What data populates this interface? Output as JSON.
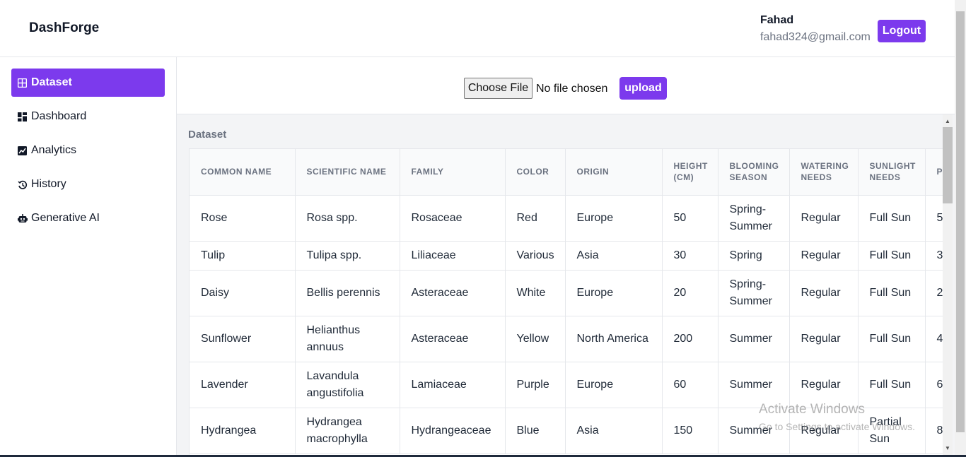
{
  "header": {
    "brand": "DashForge",
    "user_name": "Fahad",
    "user_email": "fahad324@gmail.com",
    "logout_label": "Logout",
    "accent_color": "#7c3aed"
  },
  "sidebar": {
    "items": [
      {
        "label": "Dataset",
        "icon": "grid-icon",
        "active": true
      },
      {
        "label": "Dashboard",
        "icon": "dashboard-icon",
        "active": false
      },
      {
        "label": "Analytics",
        "icon": "chart-icon",
        "active": false
      },
      {
        "label": "History",
        "icon": "history-icon",
        "active": false
      },
      {
        "label": "Generative AI",
        "icon": "robot-icon",
        "active": false
      }
    ]
  },
  "upload": {
    "choose_label": "Choose File",
    "status": "No file chosen",
    "upload_label": "upload"
  },
  "dataset": {
    "title": "Dataset",
    "columns": [
      "COMMON NAME",
      "SCIENTIFIC NAME",
      "FAMILY",
      "COLOR",
      "ORIGIN",
      "HEIGHT (CM)",
      "BLOOMING SEASON",
      "WATERING NEEDS",
      "SUNLIGHT NEEDS",
      "P (S"
    ],
    "rows": [
      [
        "Rose",
        "Rosa spp.",
        "Rosaceae",
        "Red",
        "Europe",
        "50",
        "Spring-Summer",
        "Regular",
        "Full Sun",
        "5"
      ],
      [
        "Tulip",
        "Tulipa spp.",
        "Liliaceae",
        "Various",
        "Asia",
        "30",
        "Spring",
        "Regular",
        "Full Sun",
        "3"
      ],
      [
        "Daisy",
        "Bellis perennis",
        "Asteraceae",
        "White",
        "Europe",
        "20",
        "Spring-Summer",
        "Regular",
        "Full Sun",
        "2"
      ],
      [
        "Sunflower",
        "Helianthus annuus",
        "Asteraceae",
        "Yellow",
        "North America",
        "200",
        "Summer",
        "Regular",
        "Full Sun",
        "4"
      ],
      [
        "Lavender",
        "Lavandula angustifolia",
        "Lamiaceae",
        "Purple",
        "Europe",
        "60",
        "Summer",
        "Regular",
        "Full Sun",
        "6"
      ],
      [
        "Hydrangea",
        "Hydrangea macrophylla",
        "Hydrangeaceae",
        "Blue",
        "Asia",
        "150",
        "Summer",
        "Regular",
        "Partial Sun",
        "8"
      ]
    ]
  },
  "watermark": {
    "title": "Activate Windows",
    "subtitle": "Go to Settings to activate Windows."
  }
}
